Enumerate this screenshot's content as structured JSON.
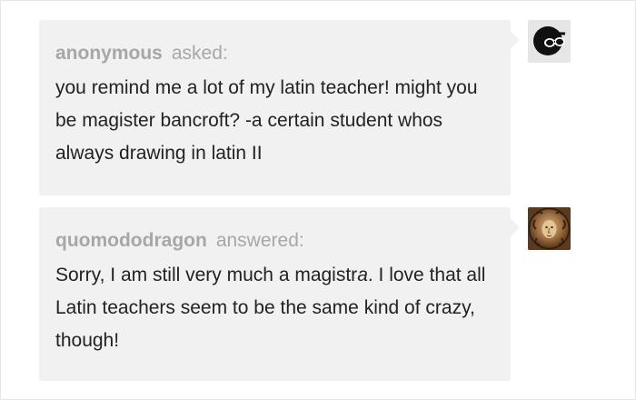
{
  "question": {
    "username": "anonymous",
    "verb": "asked:",
    "text": "you remind me a lot of my latin teacher! might you be magister bancroft? -a certain student whos always drawing in latin II"
  },
  "answer": {
    "username": "quomododragon",
    "verb": "answered:",
    "text_before": "Sorry, I am still very much a magistr",
    "text_italic": "a",
    "text_after": ". I love that all Latin teachers seem to be the same kind of crazy, though!"
  },
  "icons": {
    "question_avatar": "anonymous-sunglasses-avatar-icon",
    "answer_avatar": "medusa-medallion-avatar-icon"
  },
  "colors": {
    "bubble_background": "#f1f1f1",
    "username": "#a7a7a7",
    "body_text": "#222222"
  }
}
